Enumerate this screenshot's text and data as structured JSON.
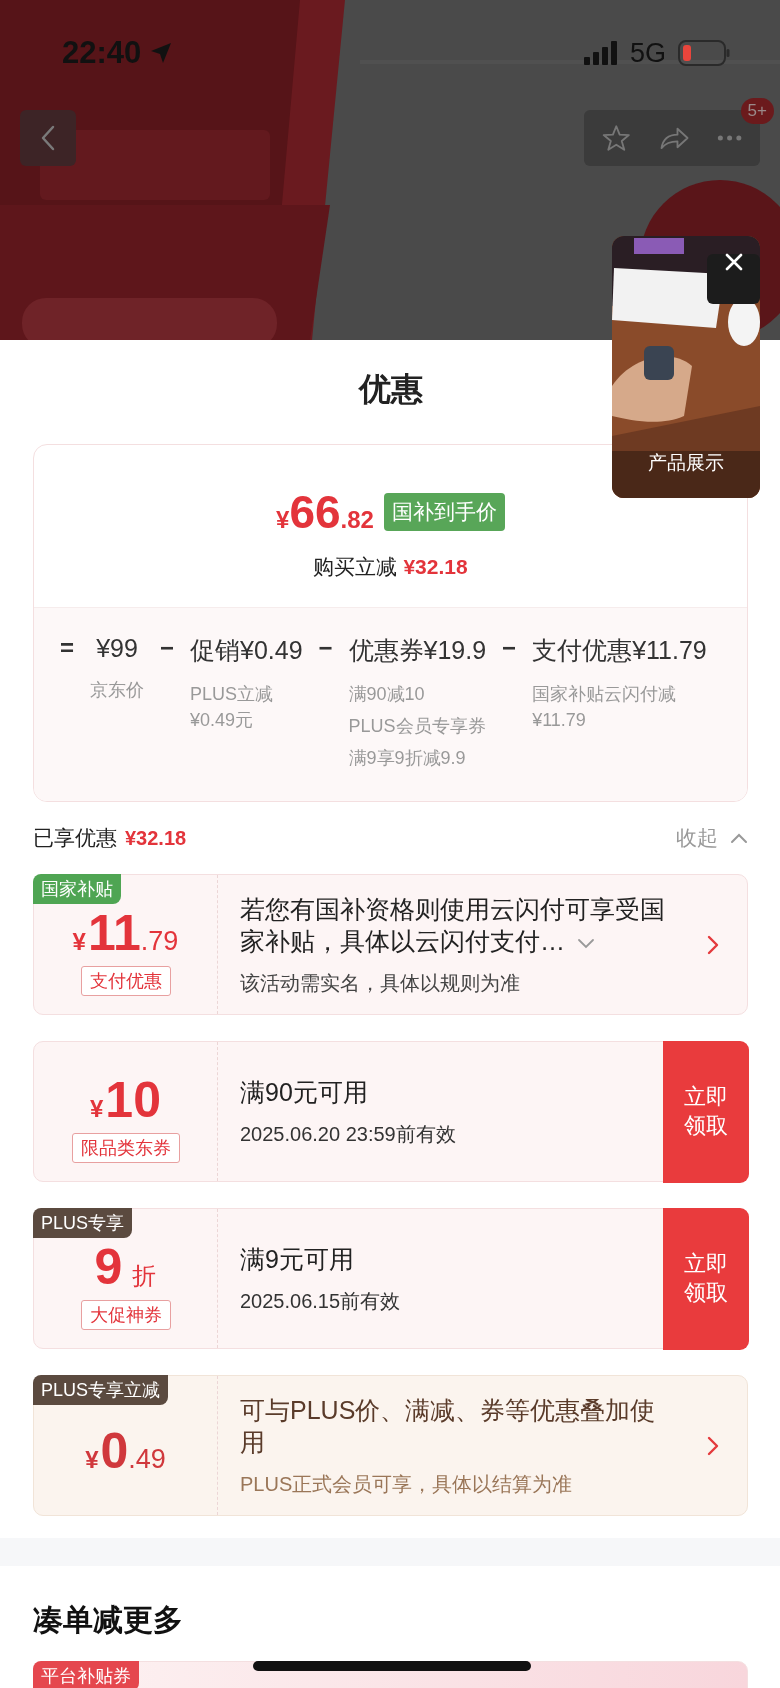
{
  "status_bar": {
    "time": "22:40",
    "network": "5G"
  },
  "nav": {
    "badge": "5+"
  },
  "video_popup": {
    "label": "产品展示"
  },
  "sheet": {
    "title": "优惠"
  },
  "summary": {
    "price": {
      "symbol": "¥",
      "integer": "66",
      "decimal": ".82"
    },
    "tag": "国补到手价",
    "saving_label": "购买立减",
    "saving_amount": "¥32.18",
    "breakdown": [
      {
        "operator": "=",
        "amount": "¥99",
        "notes": [
          "京东价"
        ]
      },
      {
        "operator": "−",
        "amount": "促销¥0.49",
        "notes": [
          "PLUS立减¥0.49元"
        ]
      },
      {
        "operator": "−",
        "amount": "优惠券¥19.9",
        "notes": [
          "满90减10",
          "PLUS会员专享券",
          "满9享9折减9.9"
        ]
      },
      {
        "operator": "−",
        "amount": "支付优惠¥11.79",
        "notes": [
          "国家补贴云闪付减¥11.79"
        ]
      }
    ]
  },
  "enjoyed": {
    "label": "已享优惠",
    "amount": "¥32.18",
    "toggle": "收起",
    "expanded": true
  },
  "coupons": [
    {
      "kind": "subsidy",
      "tag": "国家补贴",
      "color": "#4fa553",
      "value": {
        "kind": "amount",
        "symbol": "¥",
        "integer": "11",
        "decimal": ".79"
      },
      "label": "支付优惠",
      "title": "若您有国补资格则使用云闪付可享受国家补贴，具体以云闪付支付…",
      "expandable": true,
      "note": "该活动需实名，具体以规则为准",
      "action": {
        "kind": "arrow"
      }
    },
    {
      "kind": "coupon",
      "value": {
        "kind": "amount",
        "symbol": "¥",
        "integer": "10"
      },
      "label": "限品类东券",
      "title": "满90元可用",
      "note": "2025.06.20 23:59前有效",
      "action": {
        "kind": "button",
        "text": "立即领取"
      }
    },
    {
      "kind": "coupon",
      "tag": "PLUS专享",
      "color": "#5b4a3f",
      "value": {
        "kind": "discount",
        "number": "9",
        "unit": "折"
      },
      "label": "大促神券",
      "title": "满9元可用",
      "note": "2025.06.15前有效",
      "action": {
        "kind": "button",
        "text": "立即领取"
      }
    },
    {
      "kind": "plus",
      "tag": "PLUS专享立减",
      "color": "#5b4a3f",
      "value": {
        "kind": "amount",
        "symbol": "¥",
        "integer": "0",
        "decimal": ".49"
      },
      "title": "可与PLUS价、满减、券等优惠叠加使用",
      "note": "PLUS正式会员可享，具体以结算为准",
      "action": {
        "kind": "arrow"
      }
    }
  ],
  "more": {
    "title": "凑单减更多",
    "coupons": [
      {
        "kind": "platform",
        "tag": "平台补贴券",
        "color": "#e5474e"
      }
    ]
  }
}
